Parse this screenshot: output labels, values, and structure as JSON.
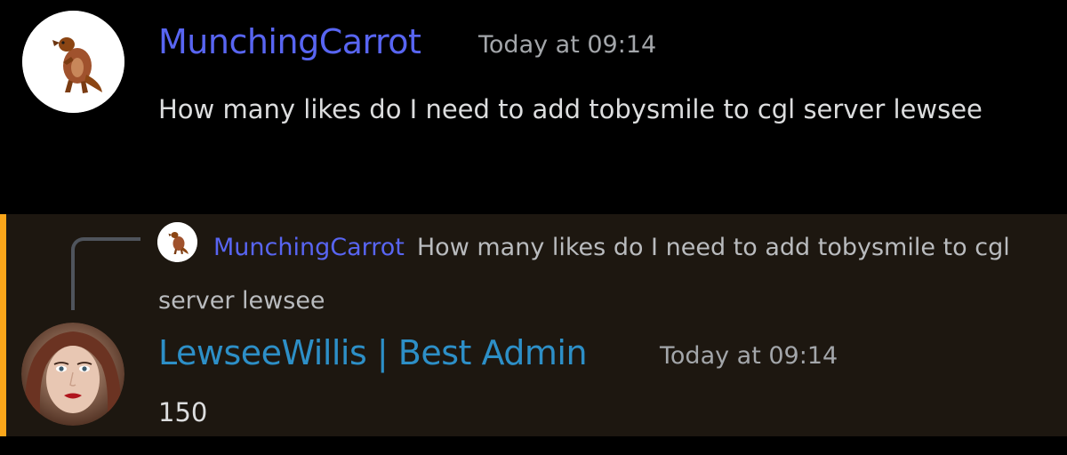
{
  "colors": {
    "background": "#000000",
    "highlight_background": "#1d1710",
    "highlight_accent": "#faa61a",
    "username_author1": "#5865f2",
    "username_author2": "#2d8fc7",
    "timestamp": "#a3a6aa",
    "message_text": "#dcddde",
    "reply_reference_text": "#b9bbbe"
  },
  "messages": [
    {
      "author": "MunchingCarrot",
      "timestamp": "Today at 09:14",
      "content": "How many likes do I need to add tobysmile to cgl server lewsee",
      "avatar_icon": "otter-avatar-icon"
    },
    {
      "reply_to": {
        "author": "MunchingCarrot",
        "content": "How many likes do I need to add tobysmile to cgl server lewsee",
        "avatar_icon": "otter-avatar-icon"
      },
      "author": "LewseeWillis | Best Admin",
      "timestamp": "Today at 09:14",
      "content": "150",
      "avatar_icon": "woman-portrait-avatar-icon"
    }
  ]
}
